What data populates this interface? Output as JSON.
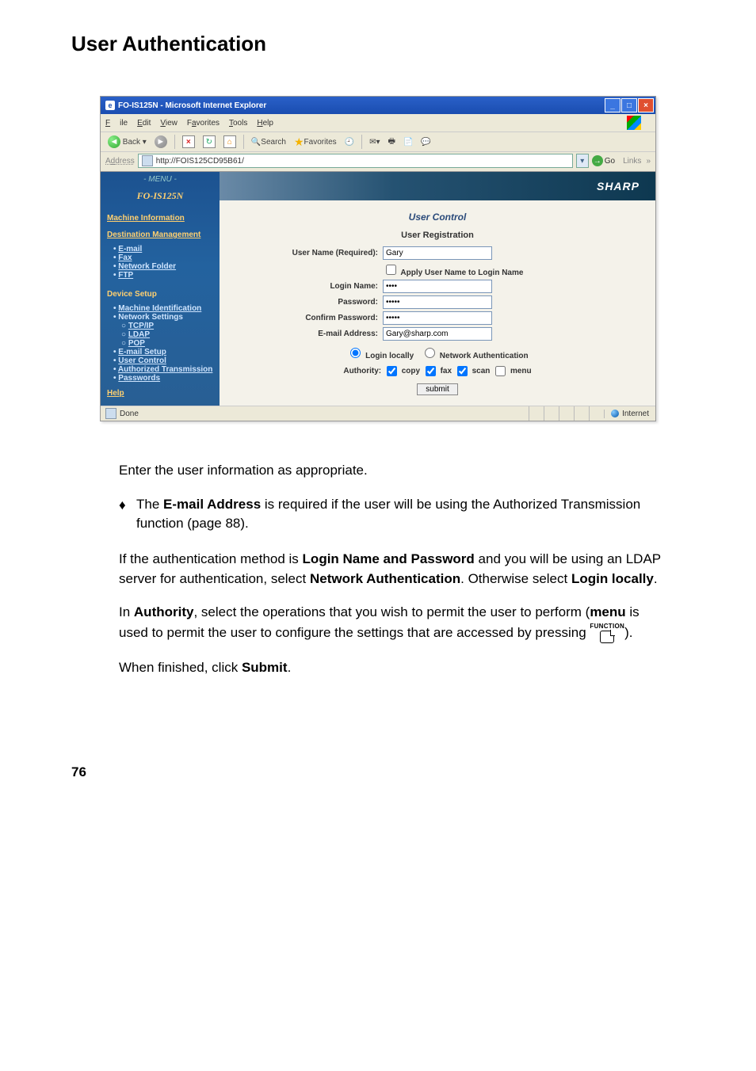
{
  "page": {
    "title": "User Authentication",
    "number": "76"
  },
  "screenshot": {
    "window_title": "FO-IS125N - Microsoft Internet Explorer",
    "menus": {
      "file": "File",
      "edit": "Edit",
      "view": "View",
      "favorites": "Favorites",
      "tools": "Tools",
      "help": "Help"
    },
    "toolbar": {
      "back": "Back",
      "search": "Search",
      "favorites": "Favorites"
    },
    "address": {
      "label": "Address",
      "url": "http://FOIS125CD95B61/",
      "go": "Go",
      "links": "Links"
    },
    "sidebar": {
      "menu_hdr": "- MENU -",
      "model": "FO-IS125N",
      "machine_info": "Machine Information",
      "dest_mgmt": "Destination Management",
      "dest_items": {
        "email": "E-mail",
        "fax": "Fax",
        "nfolder": "Network Folder",
        "ftp": "FTP"
      },
      "device_setup": "Device Setup",
      "device_items": {
        "machine_id": "Machine Identification",
        "network": "Network Settings",
        "tcpip": "TCP/IP",
        "ldap": "LDAP",
        "pop": "POP",
        "email_setup": "E-mail Setup",
        "user_control": "User Control",
        "auth_trans": "Authorized Transmission",
        "passwords": "Passwords"
      },
      "help": "Help"
    },
    "main": {
      "brand": "SHARP",
      "heading": "User Control",
      "subheading": "User Registration",
      "fields": {
        "username_lbl": "User Name (Required):",
        "username_val": "Gary",
        "apply_lbl": "Apply User Name to Login Name",
        "login_lbl": "Login Name:",
        "login_val": "••••",
        "password_lbl": "Password:",
        "password_val": "•••••",
        "confirm_lbl": "Confirm Password:",
        "confirm_val": "•••••",
        "email_lbl": "E-mail Address:",
        "email_val": "Gary@sharp.com"
      },
      "auth": {
        "local": "Login locally",
        "network": "Network Authentication"
      },
      "authority": {
        "label": "Authority:",
        "copy": "copy",
        "fax": "fax",
        "scan": "scan",
        "menu": "menu"
      },
      "submit": "submit"
    },
    "status": {
      "done": "Done",
      "zone": "Internet"
    }
  },
  "body": {
    "intro": "Enter the user information as appropriate.",
    "bullet_pre": "The ",
    "bullet_bold": "E-mail Address",
    "bullet_post": " is required if the user will be using the Authorized Transmission function (page 88).",
    "p2a": "If the authentication method is ",
    "p2b": "Login Name and Password",
    "p2c": " and you will be using an LDAP server for authentication, select ",
    "p2d": "Network Authentication",
    "p2e": ". Otherwise select ",
    "p2f": "Login locally",
    "p2g": ".",
    "p3a": "In ",
    "p3b": "Authority",
    "p3c": ", select the operations that you wish to permit the user to perform (",
    "p3d": "menu",
    "p3e": " is used to permit the user to configure the settings that are accessed by pressing ",
    "func": "FUNCTION",
    "p3f": ").",
    "p4a": "When finished, click ",
    "p4b": "Submit",
    "p4c": "."
  }
}
